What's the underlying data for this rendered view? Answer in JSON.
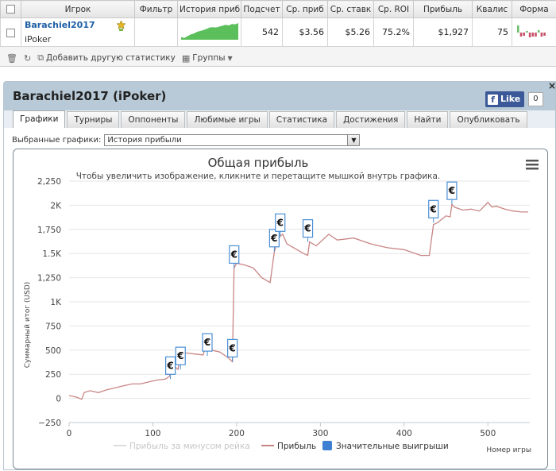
{
  "stats_table": {
    "headers": [
      "Игрок",
      "Фильтр",
      "История прибыли",
      "Подсчет",
      "Ср. приб",
      "Ср. ставк",
      "Ср. ROI",
      "Прибыль",
      "Квалис",
      "Форма"
    ],
    "row": {
      "player_name": "Barachiel2017",
      "player_site": "iPoker",
      "filter": "",
      "hands": "542",
      "avg_profit": "$3.56",
      "avg_stake": "$5.26",
      "avg_roi": "75.2%",
      "profit": "$1,927",
      "ability": "75",
      "remove_link": "x"
    },
    "history_sparkline": [
      0.15,
      0.1,
      0.2,
      0.3,
      0.35,
      0.45,
      0.5,
      0.55,
      0.62,
      0.7,
      0.72,
      0.7,
      0.75,
      0.8,
      0.85,
      0.82,
      0.9,
      0.88,
      0.95
    ],
    "form_bars": [
      0.9,
      -0.5,
      -0.4,
      0.2,
      -0.6,
      -0.5,
      -0.5,
      0.3,
      -0.5,
      -0.4
    ]
  },
  "toolbar": {
    "add_stat_label": "Добавить другую статистику",
    "groups_label": "Группы"
  },
  "panel": {
    "title": "Barachiel2017 (iPoker)",
    "like_label": "Like",
    "like_count": "0",
    "close_label": "×",
    "tabs": [
      "Графики",
      "Турниры",
      "Оппоненты",
      "Любимые игры",
      "Статистика",
      "Достижения",
      "Найти",
      "Опубликовать"
    ],
    "active_tab": 0,
    "select_label": "Выбранные графики:",
    "select_value": "История прибыли"
  },
  "chart_data": {
    "type": "line",
    "title": "Общая прибыль",
    "subtitle": "Чтобы увеличить изображение, кликните и перетащите мышкой внутрь графика.",
    "ylabel": "Суммарный итог (USD)",
    "xlabel": "Номер игры",
    "xlim": [
      0,
      550
    ],
    "ylim": [
      -250,
      2250
    ],
    "x_ticks": [
      0,
      100,
      200,
      300,
      400,
      500
    ],
    "y_ticks": [
      -250,
      0,
      250,
      500,
      750,
      1000,
      1250,
      1500,
      1750,
      2000,
      2250
    ],
    "y_tick_labels": [
      "−250",
      "0",
      "250",
      "500",
      "750",
      "1K",
      "1,250",
      "1.5K",
      "1,750",
      "2K",
      "2,250"
    ],
    "legend": [
      "Прибыль за минусом рейка",
      "Прибыль",
      "Значительные выигрыши"
    ],
    "legend_placement": "bottom",
    "series_color": "#c98585",
    "marker_color": "#4a8fd4",
    "series": [
      {
        "name": "Прибыль",
        "x": [
          0,
          10,
          15,
          18,
          25,
          35,
          45,
          55,
          65,
          75,
          85,
          95,
          105,
          115,
          120,
          122,
          130,
          133,
          140,
          150,
          160,
          165,
          170,
          180,
          190,
          195,
          197,
          200,
          210,
          220,
          230,
          240,
          245,
          248,
          252,
          255,
          260,
          270,
          280,
          285,
          287,
          295,
          310,
          320,
          340,
          360,
          380,
          400,
          420,
          430,
          435,
          440,
          450,
          455,
          457,
          460,
          470,
          480,
          490,
          500,
          505,
          510,
          520,
          530,
          540,
          548
        ],
        "y": [
          30,
          10,
          -10,
          60,
          80,
          60,
          90,
          110,
          130,
          150,
          150,
          170,
          190,
          200,
          230,
          360,
          300,
          450,
          470,
          460,
          450,
          600,
          500,
          480,
          420,
          380,
          1350,
          1400,
          1380,
          1350,
          1250,
          1200,
          1520,
          1600,
          1680,
          1700,
          1600,
          1550,
          1500,
          1480,
          1620,
          1580,
          1700,
          1640,
          1660,
          1600,
          1560,
          1540,
          1480,
          1480,
          1800,
          1820,
          1890,
          1880,
          2010,
          1980,
          1950,
          1960,
          1940,
          2030,
          1980,
          1990,
          1960,
          1940,
          1930,
          1930
        ]
      }
    ],
    "big_wins": [
      {
        "x": 121,
        "y": 200
      },
      {
        "x": 133,
        "y": 300
      },
      {
        "x": 165,
        "y": 440
      },
      {
        "x": 195,
        "y": 380
      },
      {
        "x": 197,
        "y": 1350
      },
      {
        "x": 245,
        "y": 1520
      },
      {
        "x": 252,
        "y": 1680
      },
      {
        "x": 285,
        "y": 1620
      },
      {
        "x": 435,
        "y": 1820
      },
      {
        "x": 457,
        "y": 2010
      }
    ],
    "big_win_symbol": "€"
  }
}
